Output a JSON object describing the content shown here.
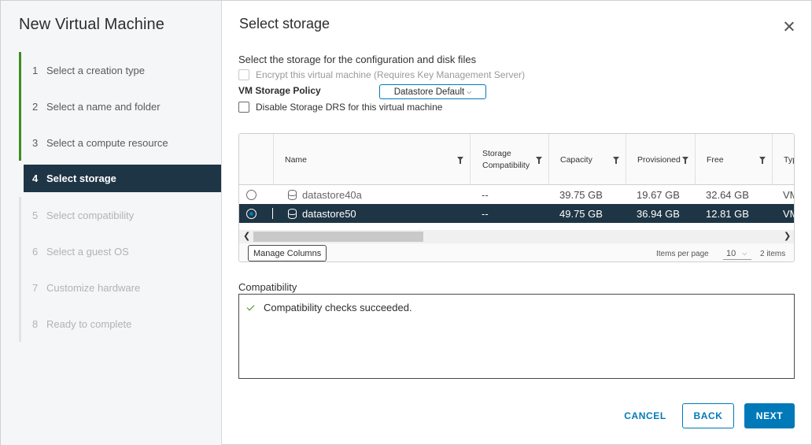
{
  "wizard": {
    "title": "New Virtual Machine",
    "steps": [
      {
        "num": "1",
        "label": "Select a creation type",
        "state": "done"
      },
      {
        "num": "2",
        "label": "Select a name and folder",
        "state": "done"
      },
      {
        "num": "3",
        "label": "Select a compute resource",
        "state": "done"
      },
      {
        "num": "4",
        "label": "Select storage",
        "state": "active"
      },
      {
        "num": "5",
        "label": "Select compatibility",
        "state": "todo"
      },
      {
        "num": "6",
        "label": "Select a guest OS",
        "state": "todo"
      },
      {
        "num": "7",
        "label": "Customize hardware",
        "state": "todo"
      },
      {
        "num": "8",
        "label": "Ready to complete",
        "state": "todo"
      }
    ]
  },
  "page": {
    "title": "Select storage",
    "instruction": "Select the storage for the configuration and disk files",
    "encrypt_label": "Encrypt this virtual machine (Requires Key Management Server)",
    "policy_label": "VM Storage Policy",
    "policy_value": "Datastore Default",
    "disable_drs_label": "Disable Storage DRS for this virtual machine"
  },
  "table": {
    "columns": {
      "name": "Name",
      "storage_compat_1": "Storage",
      "storage_compat_2": "Compatibility",
      "capacity": "Capacity",
      "provisioned": "Provisioned",
      "free": "Free",
      "type": "Typ"
    },
    "rows": [
      {
        "name": "datastore40a",
        "compat": "--",
        "capacity": "39.75 GB",
        "provisioned": "19.67 GB",
        "free": "32.64 GB",
        "type": "VM",
        "selected": false
      },
      {
        "name": "datastore50",
        "compat": "--",
        "capacity": "49.75 GB",
        "provisioned": "36.94 GB",
        "free": "12.81 GB",
        "type": "VM",
        "selected": true
      }
    ],
    "manage_columns_label": "Manage Columns",
    "items_per_page_label": "Items per page",
    "items_per_page_value": "10",
    "item_count": "2 items"
  },
  "compatibility": {
    "label": "Compatibility",
    "message": "Compatibility checks succeeded."
  },
  "footer": {
    "cancel_label": "CANCEL",
    "back_label": "BACK",
    "next_label": "NEXT"
  },
  "colors": {
    "accent": "#0079b8",
    "selected_row": "#1e3545",
    "done_green": "#3e8e1e"
  }
}
